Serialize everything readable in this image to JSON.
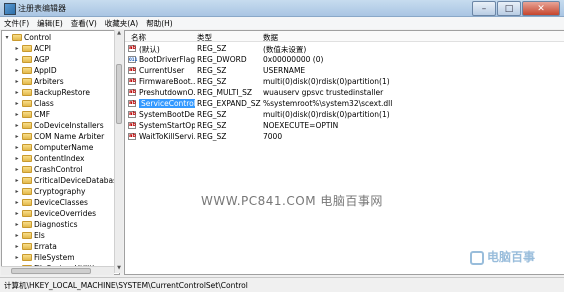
{
  "window": {
    "title": "注册表编辑器"
  },
  "menu": [
    "文件(F)",
    "编辑(E)",
    "查看(V)",
    "收藏夹(A)",
    "帮助(H)"
  ],
  "tree": {
    "root": "Control",
    "items": [
      "ACPI",
      "AGP",
      "AppID",
      "Arbiters",
      "BackupRestore",
      "Class",
      "CMF",
      "CoDeviceInstallers",
      "COM Name Arbiter",
      "ComputerName",
      "ContentIndex",
      "CrashControl",
      "CriticalDeviceDatabase",
      "Cryptography",
      "DeviceClasses",
      "DeviceOverrides",
      "Diagnostics",
      "Els",
      "Errata",
      "FileSystem",
      "FileSystemUtilities"
    ]
  },
  "list": {
    "headers": {
      "name": "名称",
      "type": "类型",
      "data": "数据"
    },
    "rows": [
      {
        "icon": "ab",
        "name": "(默认)",
        "type": "REG_SZ",
        "data": "(数值未设置)"
      },
      {
        "icon": "bin",
        "name": "BootDriverFlags",
        "type": "REG_DWORD",
        "data": "0x00000000 (0)"
      },
      {
        "icon": "ab",
        "name": "CurrentUser",
        "type": "REG_SZ",
        "data": "USERNAME"
      },
      {
        "icon": "ab",
        "name": "FirmwareBoot...",
        "type": "REG_SZ",
        "data": "multi(0)disk(0)rdisk(0)partition(1)"
      },
      {
        "icon": "ab",
        "name": "PreshutdownO...",
        "type": "REG_MULTI_SZ",
        "data": "wuauserv gpsvc trustedinstaller"
      },
      {
        "icon": "ab",
        "name": "ServiceControl...",
        "type": "REG_EXPAND_SZ",
        "data": "%systemroot%\\system32\\scext.dll",
        "selected": true
      },
      {
        "icon": "ab",
        "name": "SystemBootDe...",
        "type": "REG_SZ",
        "data": "multi(0)disk(0)rdisk(0)partition(1)"
      },
      {
        "icon": "ab",
        "name": "SystemStartOp...",
        "type": "REG_SZ",
        "data": " NOEXECUTE=OPTIN"
      },
      {
        "icon": "ab",
        "name": "WaitToKillServi...",
        "type": "REG_SZ",
        "data": "7000"
      }
    ]
  },
  "watermark": "WWW.PC841.COM 电脑百事网",
  "corner_logo": "电脑百事",
  "status": {
    "path": "计算机\\HKEY_LOCAL_MACHINE\\SYSTEM\\CurrentControlSet\\Control"
  }
}
